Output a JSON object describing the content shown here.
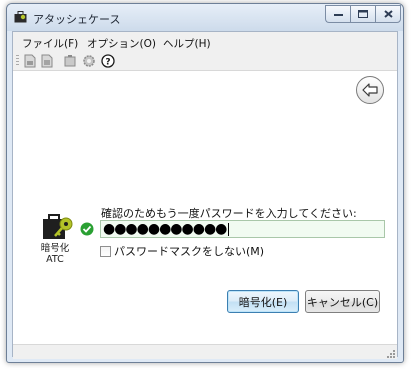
{
  "window": {
    "title": "アタッシェケース"
  },
  "menu": {
    "items": [
      "ファイル(F)",
      "オプション(O)",
      "ヘルプ(H)"
    ]
  },
  "toolbar": {
    "icons": [
      "encrypt-file-icon",
      "decrypt-file-icon",
      "delete-file-icon",
      "settings-icon",
      "help-icon"
    ]
  },
  "main": {
    "icon_label_line1": "暗号化",
    "icon_label_line2": "ATC",
    "prompt": "確認のためもう一度パスワードを入力してください:",
    "password_value": "●●●●●●●●●●●",
    "mask_label": "パスワードマスクをしない(M)",
    "mask_checked": false
  },
  "buttons": {
    "encrypt": "暗号化(E)",
    "cancel": "キャンセル(C)"
  },
  "colors": {
    "field_bg": "#f1fbf1",
    "check_green": "#2aa033",
    "default_button_border": "#3c7fb1"
  }
}
